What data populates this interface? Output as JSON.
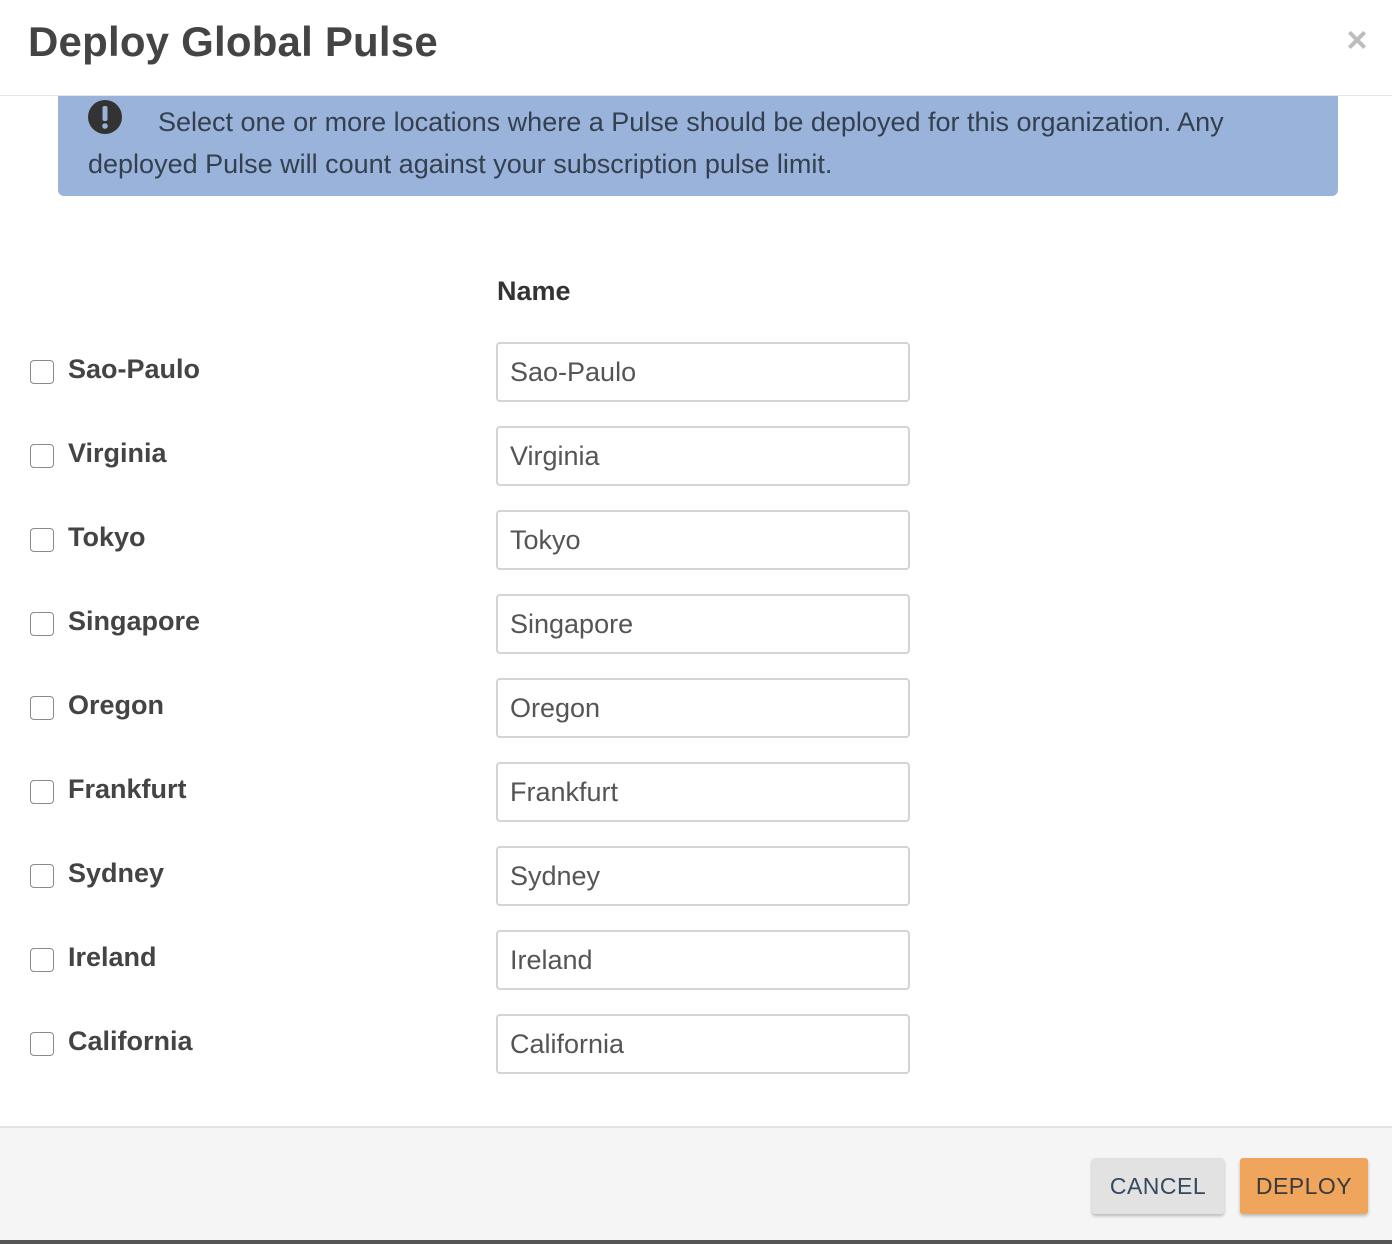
{
  "dialog": {
    "title": "Deploy Global Pulse",
    "close_label": "×"
  },
  "alert": {
    "message": "Select one or more locations where a Pulse should be deployed for this organization. Any deployed Pulse will count against your subscription pulse limit.",
    "icon": "exclamation-circle-icon",
    "background_color": "#9ab3db"
  },
  "table": {
    "column_header": "Name",
    "rows": [
      {
        "label": "Sao-Paulo",
        "value": "Sao-Paulo",
        "checked": false
      },
      {
        "label": "Virginia",
        "value": "Virginia",
        "checked": false
      },
      {
        "label": "Tokyo",
        "value": "Tokyo",
        "checked": false
      },
      {
        "label": "Singapore",
        "value": "Singapore",
        "checked": false
      },
      {
        "label": "Oregon",
        "value": "Oregon",
        "checked": false
      },
      {
        "label": "Frankfurt",
        "value": "Frankfurt",
        "checked": false
      },
      {
        "label": "Sydney",
        "value": "Sydney",
        "checked": false
      },
      {
        "label": "Ireland",
        "value": "Ireland",
        "checked": false
      },
      {
        "label": "California",
        "value": "California",
        "checked": false
      }
    ]
  },
  "footer": {
    "cancel_label": "CANCEL",
    "deploy_label": "DEPLOY",
    "deploy_color": "#efa55c"
  }
}
